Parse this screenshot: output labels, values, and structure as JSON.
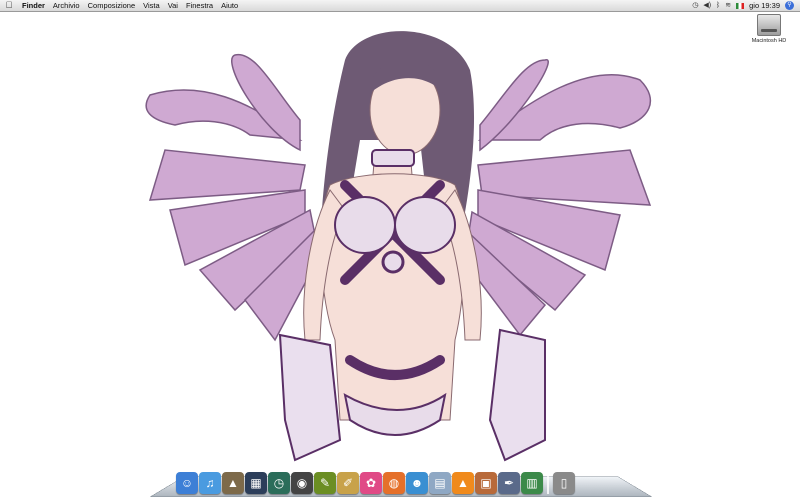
{
  "menubar": {
    "apple_glyph": "",
    "menus": [
      "Finder",
      "Archivio",
      "Composizione",
      "Vista",
      "Vai",
      "Finestra",
      "Aiuto"
    ],
    "clock": "gio 19:39",
    "status_icons": [
      "time-machine-icon",
      "volume-icon",
      "bluetooth-icon",
      "wifi-icon",
      "italian-flag-icon",
      "spotlight-icon"
    ]
  },
  "desktop": {
    "disk_label": "Macintosh HD"
  },
  "dock": {
    "apps": [
      {
        "name": "finder",
        "glyph": "☺",
        "color": "#3d7fd6"
      },
      {
        "name": "itunes",
        "glyph": "♫",
        "color": "#4a9be0"
      },
      {
        "name": "iphoto",
        "glyph": "▲",
        "color": "#7d6a4a"
      },
      {
        "name": "dashboard",
        "glyph": "▦",
        "color": "#2c3e5a"
      },
      {
        "name": "time-machine",
        "glyph": "◷",
        "color": "#2b6d5a"
      },
      {
        "name": "photo-booth",
        "glyph": "◉",
        "color": "#444444"
      },
      {
        "name": "pen-app",
        "glyph": "✎",
        "color": "#6b8e23"
      },
      {
        "name": "pencil-app",
        "glyph": "✐",
        "color": "#c8a24a"
      },
      {
        "name": "flower-app",
        "glyph": "✿",
        "color": "#e04a86"
      },
      {
        "name": "firefox",
        "glyph": "◍",
        "color": "#e5702a"
      },
      {
        "name": "messenger",
        "glyph": "☻",
        "color": "#3a8fd2"
      },
      {
        "name": "printer",
        "glyph": "▤",
        "color": "#8fa8c4"
      },
      {
        "name": "vlc",
        "glyph": "▲",
        "color": "#f08a1c"
      },
      {
        "name": "slideshow",
        "glyph": "▣",
        "color": "#b86a3a"
      },
      {
        "name": "script-editor",
        "glyph": "✒",
        "color": "#5a6a8a"
      },
      {
        "name": "activity-monitor",
        "glyph": "▥",
        "color": "#3c8a4a"
      },
      {
        "name": "trash",
        "glyph": "▯",
        "color": "#8a8a8a"
      }
    ]
  },
  "colors": {
    "wing": "#c9a3cc",
    "wing_dark": "#8a6a90",
    "hair": "#6e5a74",
    "skin": "#f6dfd8",
    "suit": "#5a2f66",
    "suit_light": "#e8dcea"
  }
}
